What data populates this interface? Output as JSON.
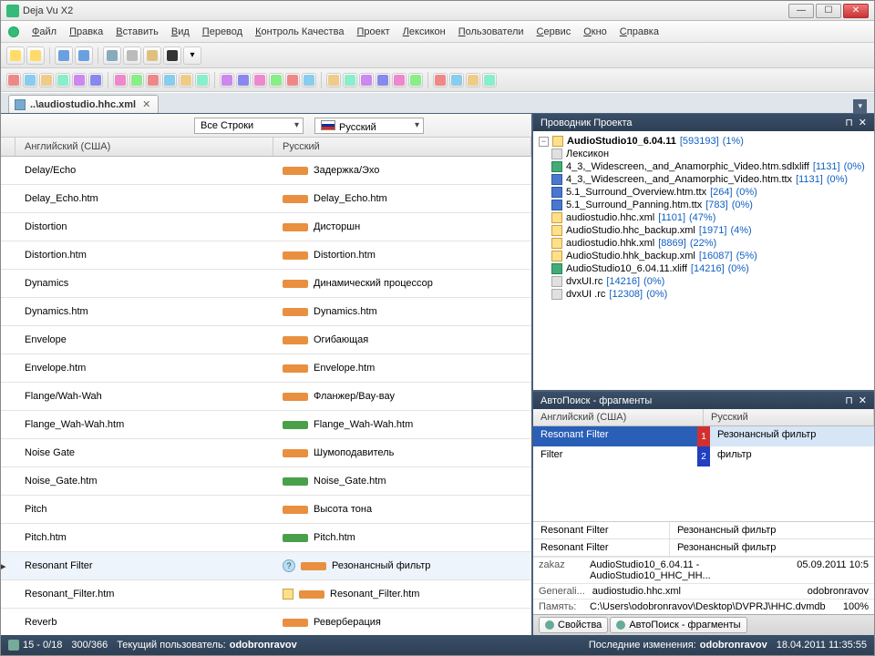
{
  "title": "Deja Vu X2",
  "menu": [
    "Файл",
    "Правка",
    "Вставить",
    "Вид",
    "Перевод",
    "Контроль Качества",
    "Проект",
    "Лексикон",
    "Пользователи",
    "Сервис",
    "Окно",
    "Справка"
  ],
  "tab": {
    "filename": "..\\audiostudio.hhc.xml"
  },
  "filter": {
    "rowsLabel": "Все Строки",
    "langLabel": "Русский"
  },
  "grid": {
    "headSource": "Английский (США)",
    "headTarget": "Русский",
    "rows": [
      {
        "src": "Delay/Echo",
        "tgt": "Задержка/Эхо",
        "bar": "orange"
      },
      {
        "src": "Delay_Echo.htm",
        "tgt": "Delay_Echo.htm",
        "bar": "orange"
      },
      {
        "src": "Distortion",
        "tgt": "Дисторшн",
        "bar": "orange"
      },
      {
        "src": "Distortion.htm",
        "tgt": "Distortion.htm",
        "bar": "orange"
      },
      {
        "src": "Dynamics",
        "tgt": "Динамический процессор",
        "bar": "orange"
      },
      {
        "src": "Dynamics.htm",
        "tgt": "Dynamics.htm",
        "bar": "orange"
      },
      {
        "src": "Envelope",
        "tgt": "Огибающая",
        "bar": "orange"
      },
      {
        "src": "Envelope.htm",
        "tgt": "Envelope.htm",
        "bar": "orange"
      },
      {
        "src": "Flange/Wah-Wah",
        "tgt": "Фланжер/Вау-вау",
        "bar": "orange"
      },
      {
        "src": "Flange_Wah-Wah.htm",
        "tgt": "Flange_Wah-Wah.htm",
        "bar": "green"
      },
      {
        "src": "Noise Gate",
        "tgt": "Шумоподавитель",
        "bar": "orange"
      },
      {
        "src": "Noise_Gate.htm",
        "tgt": "Noise_Gate.htm",
        "bar": "green"
      },
      {
        "src": "Pitch",
        "tgt": "Высота тона",
        "bar": "orange"
      },
      {
        "src": "Pitch.htm",
        "tgt": "Pitch.htm",
        "bar": "green"
      },
      {
        "src": "Resonant Filter",
        "tgt": "Резонансный фильтр",
        "bar": "orange",
        "sel": true,
        "q": true
      },
      {
        "src": "Resonant_Filter.htm",
        "tgt": "Resonant_Filter.htm",
        "bar": "orange",
        "fold": true
      },
      {
        "src": "Reverb",
        "tgt": "Реверберация",
        "bar": "orange"
      }
    ]
  },
  "project": {
    "title": "Проводник Проекта",
    "root": {
      "name": "AudioStudio10_6.04.11",
      "size": "[593193]",
      "pct": "(1%)"
    },
    "lexicon": "Лексикон",
    "files": [
      {
        "ico": "x",
        "name": "4_3,_Widescreen,_and_Anamorphic_Video.htm.sdlxliff",
        "size": "[1131]",
        "pct": "(0%)"
      },
      {
        "ico": "b",
        "name": "4_3,_Widescreen,_and_Anamorphic_Video.htm.ttx",
        "size": "[1131]",
        "pct": "(0%)"
      },
      {
        "ico": "b",
        "name": "5.1_Surround_Overview.htm.ttx",
        "size": "[264]",
        "pct": "(0%)"
      },
      {
        "ico": "b",
        "name": "5.1_Surround_Panning.htm.ttx",
        "size": "[783]",
        "pct": "(0%)"
      },
      {
        "ico": "t",
        "name": "audiostudio.hhc.xml",
        "size": "[1101]",
        "pct": "(47%)"
      },
      {
        "ico": "t",
        "name": "AudioStudio.hhc_backup.xml",
        "size": "[1971]",
        "pct": "(4%)"
      },
      {
        "ico": "t",
        "name": "audiostudio.hhk.xml",
        "size": "[8869]",
        "pct": "(22%)"
      },
      {
        "ico": "t",
        "name": "AudioStudio.hhk_backup.xml",
        "size": "[16087]",
        "pct": "(5%)"
      },
      {
        "ico": "x",
        "name": "AudioStudio10_6.04.11.xliff",
        "size": "[14216]",
        "pct": "(0%)"
      },
      {
        "ico": "f",
        "name": "dvxUI.rc",
        "size": "[14216]",
        "pct": "(0%)"
      },
      {
        "ico": "f",
        "name": "dvxUI .rc",
        "size": "[12308]",
        "pct": "(0%)"
      }
    ]
  },
  "autosearch": {
    "title": "АвтоПоиск - фрагменты",
    "headSource": "Английский (США)",
    "headTarget": "Русский",
    "rows": [
      {
        "src": "Resonant Filter",
        "n": "1",
        "nc": "r",
        "tgt": "Резонансный фильтр",
        "hl": true
      },
      {
        "src": "Filter",
        "n": "2",
        "nc": "b",
        "tgt": "фильтр"
      }
    ],
    "detail": [
      {
        "k": "Resonant Filter",
        "v": "Резонансный фильтр"
      },
      {
        "k": "Resonant Filter",
        "v": "Резонансный фильтр"
      }
    ],
    "foot": {
      "zakazLabel": "zakaz",
      "zakaz": "AudioStudio10_6.04.11 - AudioStudio10_HHC_HH...",
      "date": "05.09.2011 10:5",
      "genLabel": "Generali...",
      "gen": "audiostudio.hhc.xml",
      "user": "odobronravov",
      "memLabel": "Память:",
      "mem": "C:\\Users\\odobronravov\\Desktop\\DVPRJ\\HHC.dvmdb",
      "right": "100%"
    }
  },
  "bottomTabs": [
    "Свойства",
    "АвтоПоиск - фрагменты"
  ],
  "status": {
    "left": "15 - 0/18",
    "mid": "300/366",
    "userLabel": "Текущий пользователь:",
    "user": "odobronravov",
    "lastLabel": "Последние изменения:",
    "lastUser": "odobronravov",
    "date": "18.04.2011 11:35:55"
  }
}
